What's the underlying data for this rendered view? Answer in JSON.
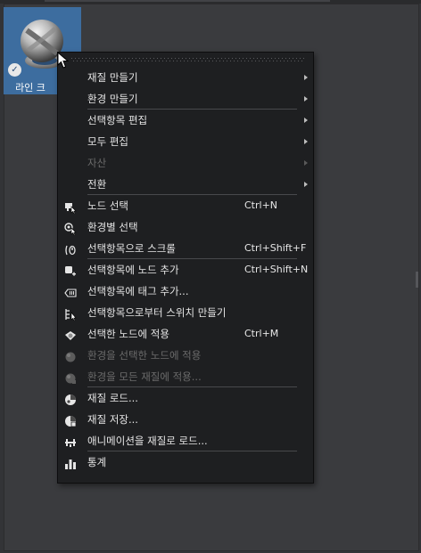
{
  "material": {
    "label": "라인 크"
  },
  "menu": {
    "items": [
      {
        "label": "재질 만들기",
        "submenu": true,
        "sep_after": false,
        "disabled": false,
        "icon": ""
      },
      {
        "label": "환경 만들기",
        "submenu": true,
        "sep_after": true,
        "disabled": false,
        "icon": ""
      },
      {
        "label": "선택항목 편집",
        "submenu": true,
        "sep_after": false,
        "disabled": false,
        "icon": ""
      },
      {
        "label": "모두 편집",
        "submenu": true,
        "sep_after": false,
        "disabled": false,
        "icon": ""
      },
      {
        "label": "자산",
        "submenu": true,
        "sep_after": false,
        "disabled": true,
        "icon": ""
      },
      {
        "label": "전환",
        "submenu": true,
        "sep_after": true,
        "disabled": false,
        "icon": ""
      },
      {
        "label": "노드 선택",
        "shortcut": "Ctrl+N",
        "sep_after": false,
        "disabled": false,
        "icon": "select-node-icon"
      },
      {
        "label": "환경별 선택",
        "sep_after": false,
        "disabled": false,
        "icon": "select-by-environment-icon"
      },
      {
        "label": "선택항목으로 스크롤",
        "shortcut": "Ctrl+Shift+F",
        "sep_after": true,
        "disabled": false,
        "icon": "scroll-to-selection-icon"
      },
      {
        "label": "선택항목에 노드 추가",
        "shortcut": "Ctrl+Shift+N",
        "sep_after": false,
        "disabled": false,
        "icon": "add-node-icon"
      },
      {
        "label": "선택항목에 태그 추가...",
        "sep_after": false,
        "disabled": false,
        "icon": "add-tag-icon"
      },
      {
        "label": "선택항목으로부터 스위치 만들기",
        "sep_after": false,
        "disabled": false,
        "icon": "create-switch-icon"
      },
      {
        "label": "선택한 노드에 적용",
        "shortcut": "Ctrl+M",
        "sep_after": false,
        "disabled": false,
        "icon": "apply-to-node-icon"
      },
      {
        "label": "환경을 선택한 노드에 적용",
        "sep_after": false,
        "disabled": true,
        "icon": "apply-environment-node-icon"
      },
      {
        "label": "환경을 모든 재질에 적용...",
        "sep_after": true,
        "disabled": true,
        "icon": "apply-environment-all-icon"
      },
      {
        "label": "재질 로드...",
        "sep_after": false,
        "disabled": false,
        "icon": "load-material-icon"
      },
      {
        "label": "재질 저장...",
        "sep_after": false,
        "disabled": false,
        "icon": "save-material-icon"
      },
      {
        "label": "애니메이션을 재질로 로드...",
        "sep_after": true,
        "disabled": false,
        "icon": "load-animation-icon"
      },
      {
        "label": "통계",
        "sep_after": false,
        "disabled": false,
        "icon": "statistics-icon"
      }
    ]
  }
}
